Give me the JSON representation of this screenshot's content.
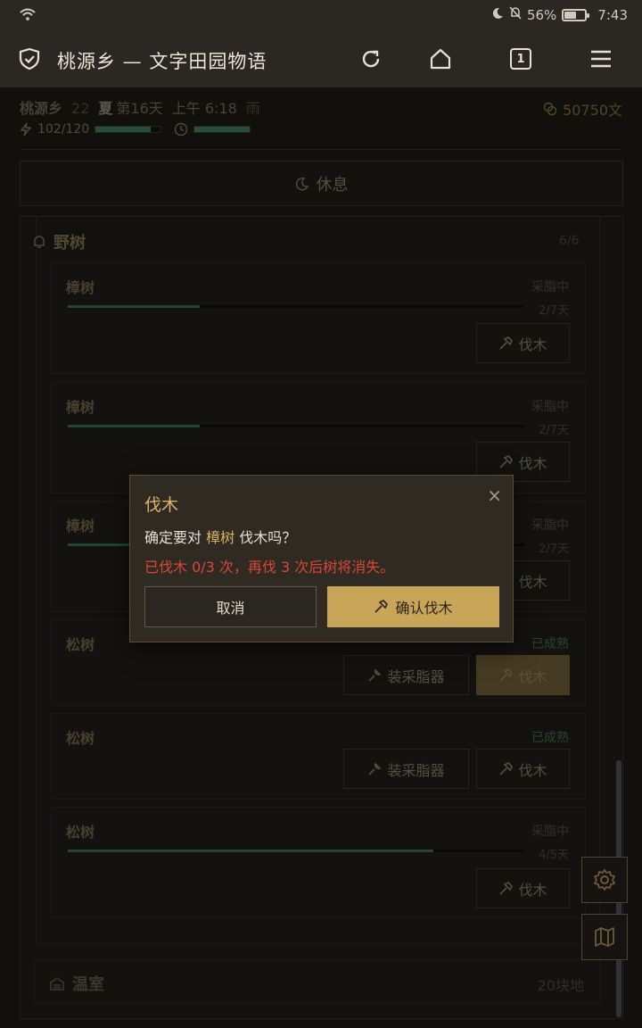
{
  "status_bar": {
    "battery": "56%",
    "time": "7:43"
  },
  "toolbar": {
    "title": "桃源乡 — 文字田园物语",
    "tab_count": "1"
  },
  "game": {
    "village": "桃源乡",
    "year": "22",
    "season": "夏",
    "day": "第16天",
    "time": "上午 6:18",
    "weather": "雨",
    "money": "50750文",
    "stamina": "102/120",
    "stamina_fraction": 0.85,
    "time_fraction": 1.0
  },
  "rest_label": "休息",
  "wild_trees": {
    "title": "野树",
    "count": "6/6",
    "cards": [
      {
        "name": "樟树",
        "status": "采脂中",
        "days": "2/7天",
        "progress": 0.29,
        "chop": "伐木"
      },
      {
        "name": "樟树",
        "status": "采脂中",
        "days": "2/7天",
        "progress": 0.29,
        "chop": "伐木"
      },
      {
        "name": "樟树",
        "status": "采脂中",
        "days": "2/7天",
        "progress": 0.29,
        "chop": "伐木"
      },
      {
        "name": "松树",
        "status": "已成熟",
        "tap": "装采脂器",
        "chop": "伐木"
      },
      {
        "name": "松树",
        "status": "已成熟",
        "tap": "装采脂器",
        "chop": "伐木"
      },
      {
        "name": "松树",
        "status": "采脂中",
        "days": "4/5天",
        "progress": 0.8,
        "chop": "伐木"
      }
    ]
  },
  "greenhouse": {
    "title": "温室",
    "count": "20块地"
  },
  "dialog": {
    "title": "伐木",
    "message_prefix": "确定要对",
    "tree_name": "樟树",
    "message_suffix": "伐木吗？",
    "warning": "已伐木 0/3 次，再伐 3 次后树将消失。",
    "cancel": "取消",
    "confirm": "确认伐木",
    "close": "×"
  }
}
